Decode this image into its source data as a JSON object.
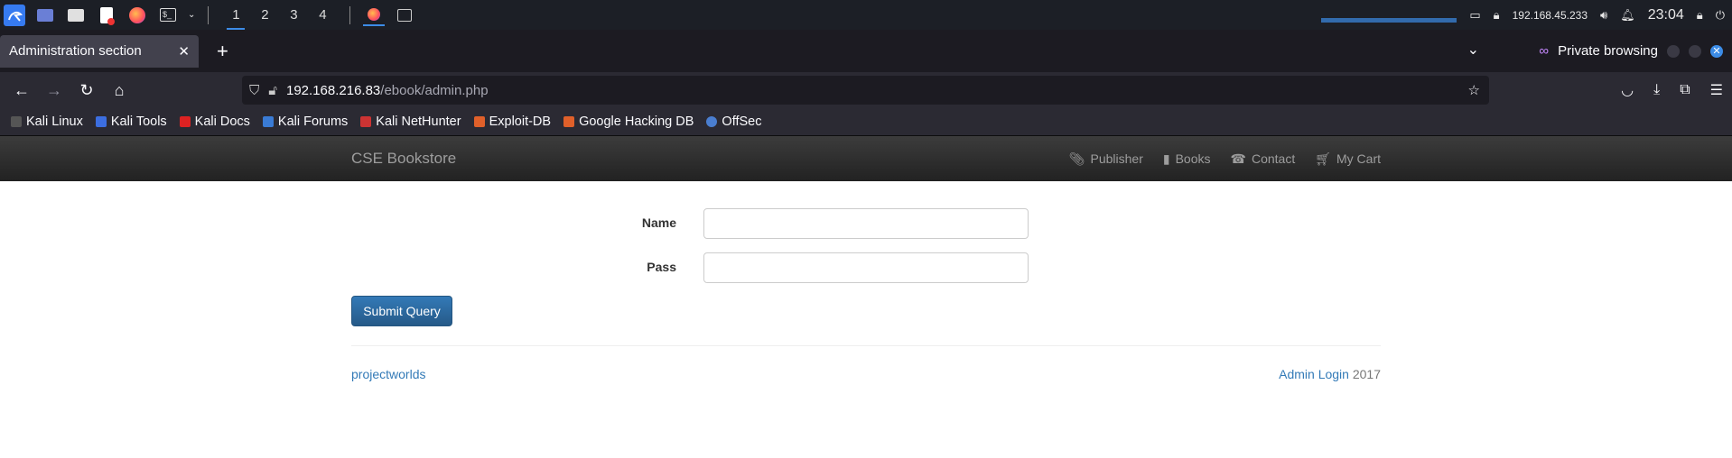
{
  "taskbar": {
    "workspaces": [
      "1",
      "2",
      "3",
      "4"
    ],
    "ip": "192.168.45.233",
    "clock": "23:04"
  },
  "browser": {
    "tab_title": "Administration section",
    "private_label": "Private browsing",
    "url_host": "192.168.216.83",
    "url_path": "/ebook/admin.php",
    "bookmarks": [
      "Kali Linux",
      "Kali Tools",
      "Kali Docs",
      "Kali Forums",
      "Kali NetHunter",
      "Exploit-DB",
      "Google Hacking DB",
      "OffSec"
    ]
  },
  "site": {
    "brand": "CSE Bookstore",
    "menu": {
      "publisher": "Publisher",
      "books": "Books",
      "contact": "Contact",
      "cart": "My Cart"
    },
    "form": {
      "name_label": "Name",
      "pass_label": "Pass",
      "submit": "Submit Query"
    },
    "footer": {
      "left": "projectworlds",
      "admin_link": "Admin Login",
      "year": "2017"
    }
  }
}
